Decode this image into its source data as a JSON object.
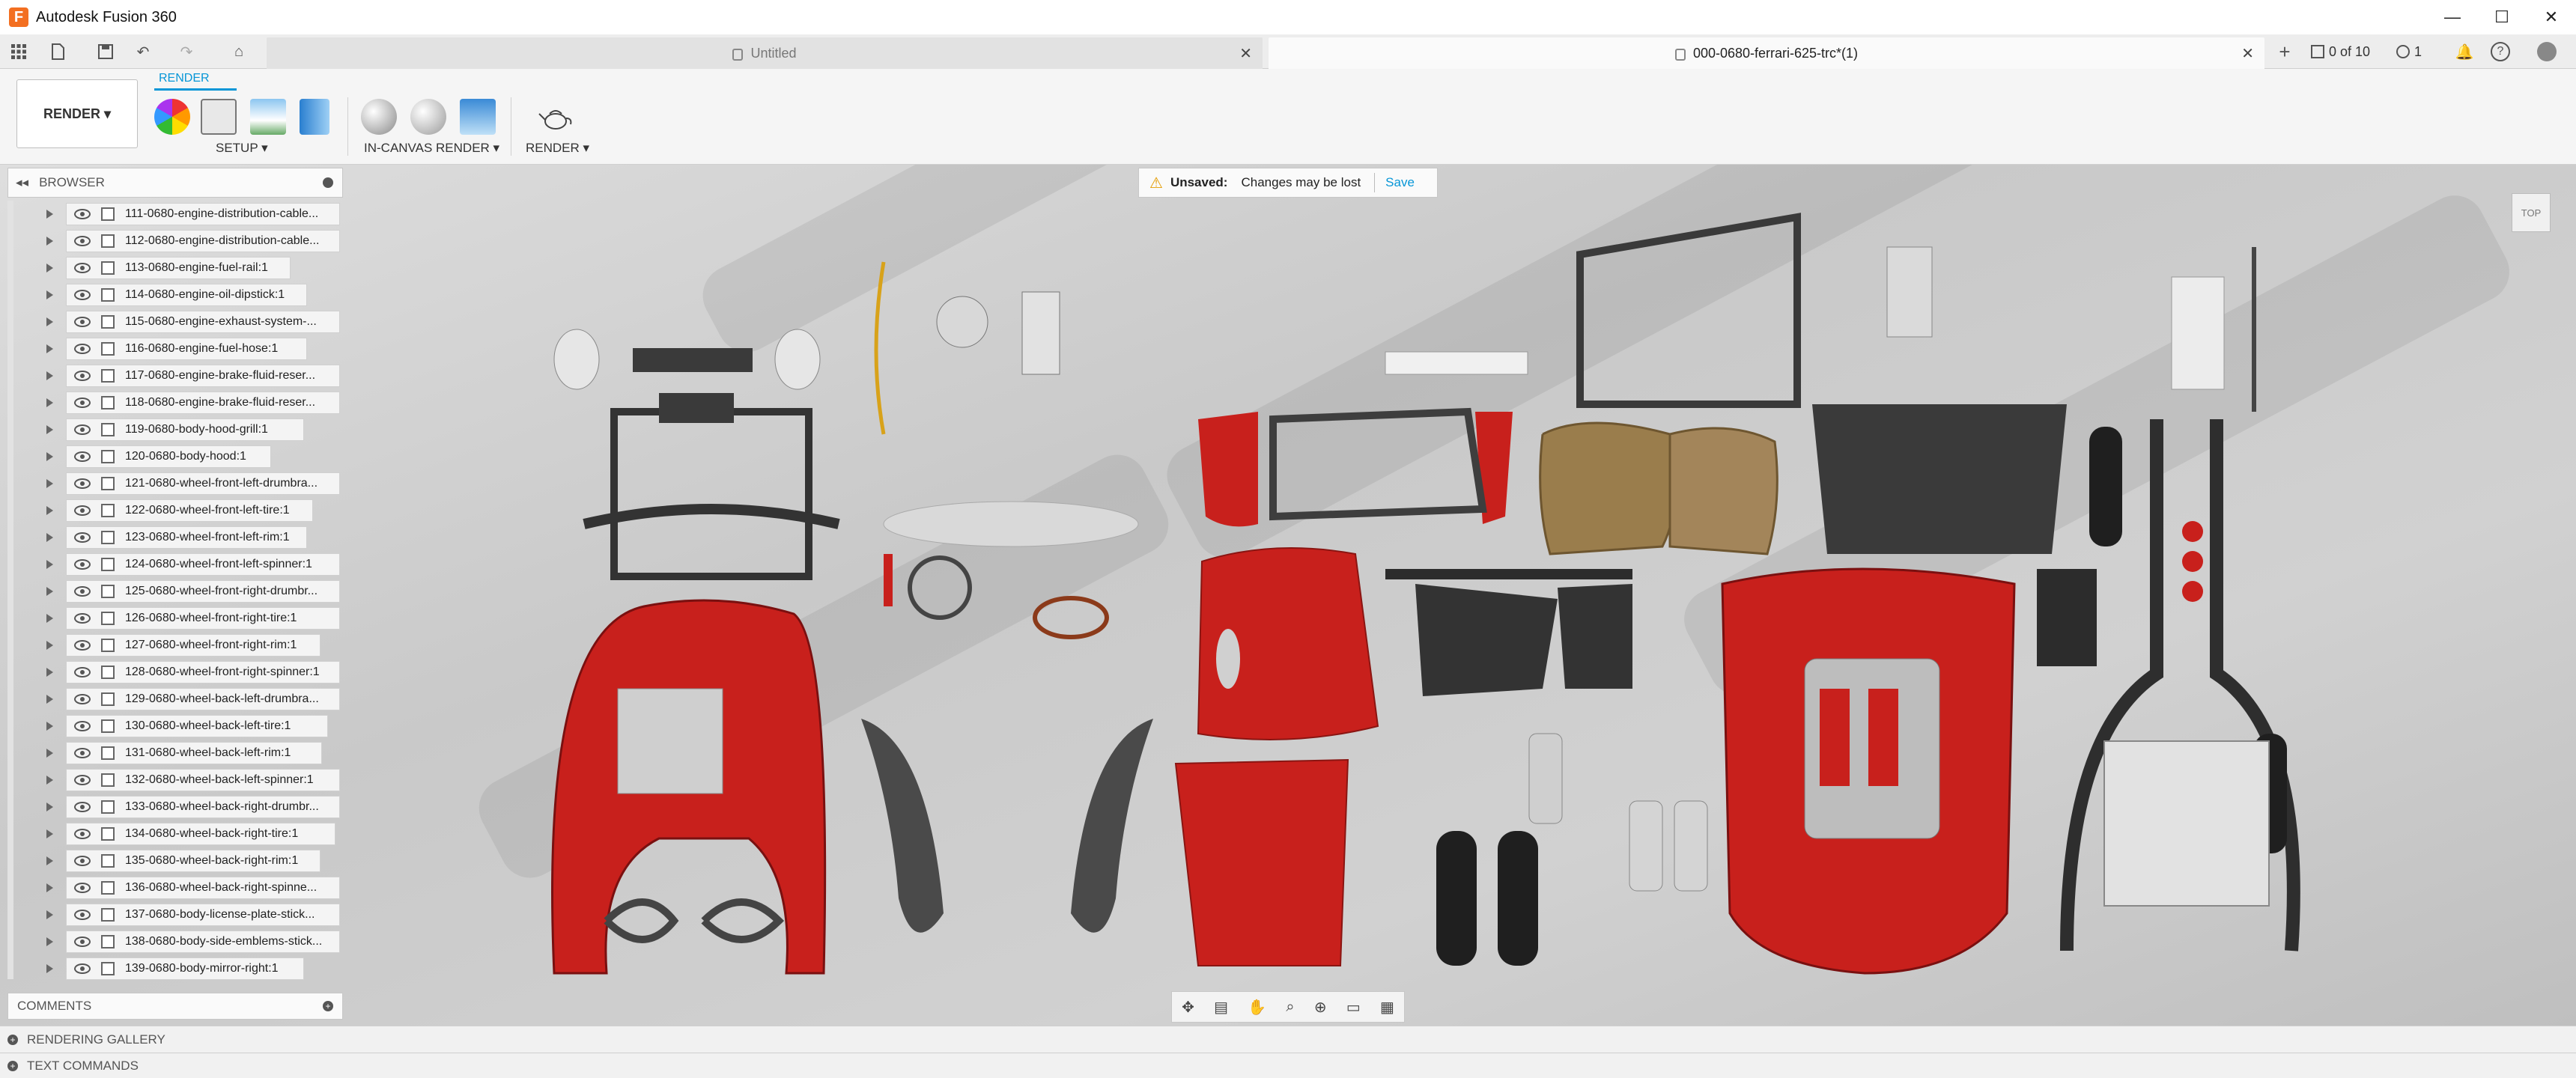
{
  "app": {
    "title": "Autodesk Fusion 360",
    "logo": "F"
  },
  "window_controls": {
    "minimize": "—",
    "maximize": "☐",
    "close": "✕"
  },
  "tabs": [
    {
      "label": "Untitled",
      "close": "✕"
    },
    {
      "label": "000-0680-ferrari-625-trc*(1)",
      "close": "✕"
    }
  ],
  "quick_access": {
    "jobs": "0 of 10",
    "notifications": "1"
  },
  "ribbon": {
    "workspace": "RENDER ▾",
    "tab": "RENDER",
    "groups": [
      "SETUP ▾",
      "IN-CANVAS RENDER ▾",
      "RENDER ▾"
    ]
  },
  "browser": {
    "title": "BROWSER",
    "items": [
      "111-0680-engine-distribution-cable...",
      "112-0680-engine-distribution-cable...",
      "113-0680-engine-fuel-rail:1",
      "114-0680-engine-oil-dipstick:1",
      "115-0680-engine-exhaust-system-...",
      "116-0680-engine-fuel-hose:1",
      "117-0680-engine-brake-fluid-reser...",
      "118-0680-engine-brake-fluid-reser...",
      "119-0680-body-hood-grill:1",
      "120-0680-body-hood:1",
      "121-0680-wheel-front-left-drumbra...",
      "122-0680-wheel-front-left-tire:1",
      "123-0680-wheel-front-left-rim:1",
      "124-0680-wheel-front-left-spinner:1",
      "125-0680-wheel-front-right-drumbr...",
      "126-0680-wheel-front-right-tire:1",
      "127-0680-wheel-front-right-rim:1",
      "128-0680-wheel-front-right-spinner:1",
      "129-0680-wheel-back-left-drumbra...",
      "130-0680-wheel-back-left-tire:1",
      "131-0680-wheel-back-left-rim:1",
      "132-0680-wheel-back-left-spinner:1",
      "133-0680-wheel-back-right-drumbr...",
      "134-0680-wheel-back-right-tire:1",
      "135-0680-wheel-back-right-rim:1",
      "136-0680-wheel-back-right-spinne...",
      "137-0680-body-license-plate-stick...",
      "138-0680-body-side-emblems-stick...",
      "139-0680-body-mirror-right:1"
    ]
  },
  "banner": {
    "status": "Unsaved:",
    "message": "Changes may be lost",
    "save": "Save"
  },
  "viewcube": {
    "face": "TOP"
  },
  "panels": {
    "comments": "COMMENTS",
    "gallery": "RENDERING GALLERY",
    "text_commands": "TEXT COMMANDS"
  },
  "colors": {
    "accent": "#0696d7",
    "body_red": "#c8201c",
    "seat_tan": "#9a7d4c",
    "dark_part": "#3a3a3a"
  }
}
